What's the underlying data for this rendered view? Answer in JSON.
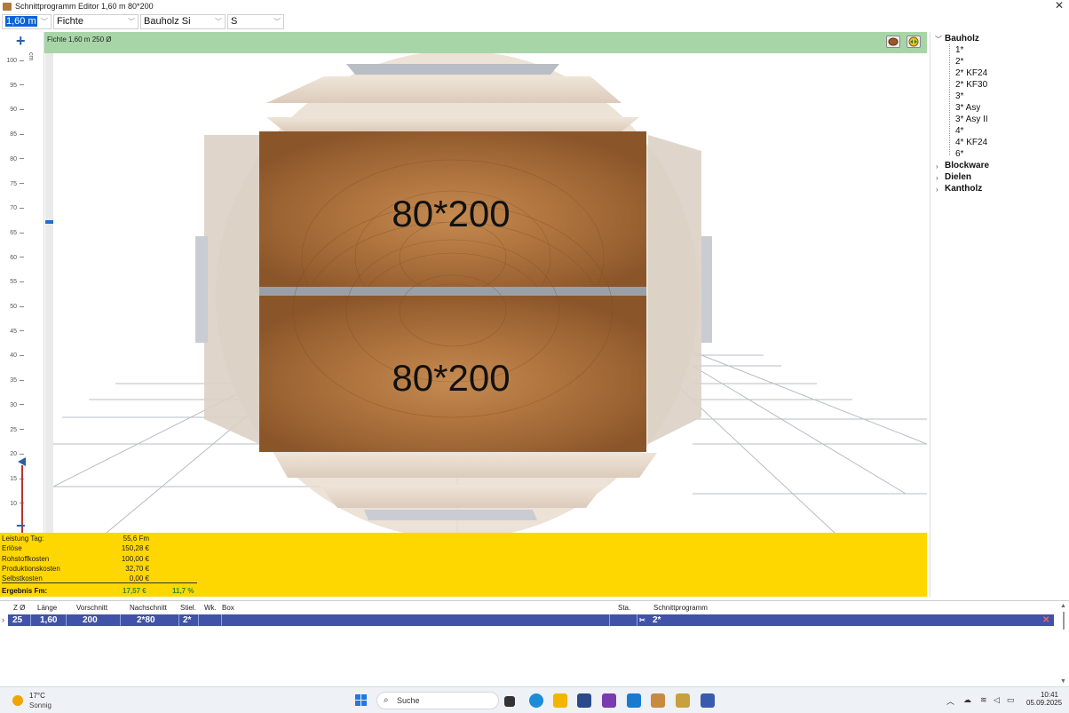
{
  "window": {
    "title": "Schnittprogramm Editor 1,60 m 80*200",
    "close_glyph": "✕"
  },
  "toolbar": {
    "length": "1,60 m",
    "wood": "Fichte",
    "category": "Bauholz Si",
    "grade": "S"
  },
  "scale": {
    "unit": "cm",
    "ticks": [
      "100",
      "95",
      "90",
      "85",
      "80",
      "75",
      "70",
      "65",
      "60",
      "55",
      "50",
      "45",
      "40",
      "35",
      "30",
      "25",
      "20",
      "15",
      "10"
    ],
    "current_value": 25
  },
  "view": {
    "header_label": "Fichte 1,60 m 250 Ø",
    "boards": [
      "80*200",
      "80*200"
    ]
  },
  "stats": {
    "rows": [
      {
        "label": "Leistung Tag:",
        "value": "55,6 Fm"
      },
      {
        "label": "Erlöse",
        "value": "150,28 €"
      },
      {
        "label": "Rohstoffkosten",
        "value": "100,00 €"
      },
      {
        "label": "Produktionskosten",
        "value": "32,70 €"
      },
      {
        "label": "Selbstkosten",
        "value": "0,00 €"
      }
    ],
    "result_label": "Ergebnis Fm:",
    "result_value": "17,57 €",
    "result_percent": "11,7 %"
  },
  "tree": {
    "groups": [
      {
        "label": "Bauholz",
        "expanded": true,
        "children": [
          "1*",
          "2*",
          "2* KF24",
          "2* KF30",
          "3*",
          "3* Asy",
          "3* Asy II",
          "4*",
          "4* KF24",
          "6*"
        ]
      },
      {
        "label": "Blockware",
        "expanded": false
      },
      {
        "label": "Dielen",
        "expanded": false
      },
      {
        "label": "Kantholz",
        "expanded": false
      }
    ]
  },
  "grid": {
    "headers": [
      "Z Ø",
      "Länge",
      "Vorschnitt",
      "Nachschnitt",
      "Stiel.",
      "Wk.",
      "Box",
      "Sta.",
      "Schnittprogramm"
    ],
    "row": {
      "z": "25",
      "laenge": "1,60",
      "vorschnitt": "200",
      "nachschnitt": "2*80",
      "stiel": "2*",
      "wk": "",
      "box": "",
      "sta": "",
      "programm": "2*"
    }
  },
  "taskbar": {
    "temperature": "17°C",
    "weather": "Sonnig",
    "search_label": "Suche",
    "time": "10:41",
    "date": "05.09.2025"
  }
}
